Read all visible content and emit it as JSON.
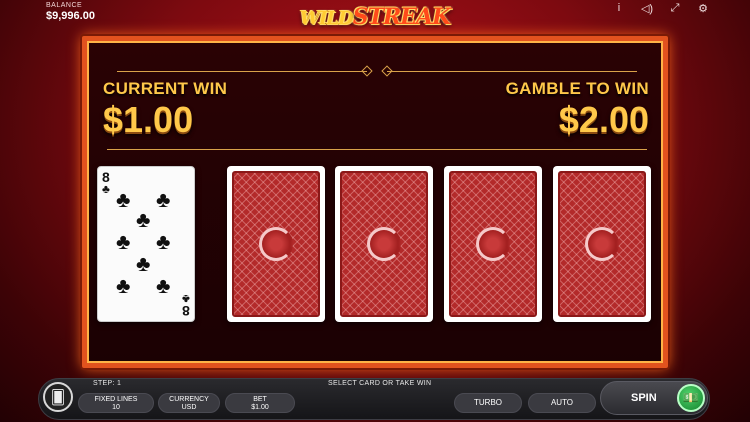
{
  "balance": {
    "label": "BALANCE",
    "value": "$9,996.00"
  },
  "logo": {
    "wild": "WILD",
    "streak": "STREAK"
  },
  "top_icons": [
    "info-icon",
    "sound-icon",
    "fullscreen-icon",
    "settings-icon"
  ],
  "gamble": {
    "current_win_label": "CURRENT WIN",
    "current_win_value": "$1.00",
    "gamble_label": "GAMBLE TO WIN",
    "gamble_value": "$2.00"
  },
  "dealer_card": {
    "rank": "8",
    "suit": "♣"
  },
  "hidden_cards_count": 4,
  "status": {
    "step": "STEP: 1",
    "message": "SELECT CARD OR TAKE WIN"
  },
  "controls": {
    "fixed_lines_label": "FIXED LINES",
    "fixed_lines_value": "10",
    "currency_label": "CURRENCY",
    "currency_value": "USD",
    "bet_label": "BET",
    "bet_value": "$1.00",
    "turbo": "TURBO",
    "auto": "AUTO",
    "spin": "SPIN"
  },
  "colors": {
    "accent_gold": "#ffc84a",
    "frame_orange": "#e2521e",
    "card_back_red": "#b32a2a",
    "spin_green": "#1fa544"
  }
}
